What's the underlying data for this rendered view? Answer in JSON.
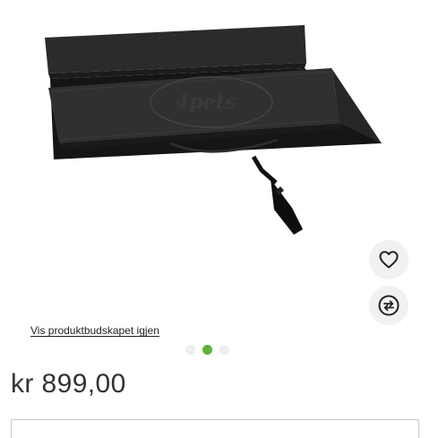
{
  "product": {
    "image_logo_text": "4pets",
    "alt": "4pets sammenleggbar bilkasse"
  },
  "actions": {
    "favorite_icon": "heart-outline-icon",
    "compare_icon": "compare-arrows-icon"
  },
  "link": {
    "revisit_label": "Vis produktbudskapet igjen"
  },
  "carousel": {
    "dot_count": 3,
    "active_index": 1,
    "active_color": "#5bb537",
    "inactive_color": "#eeeeee"
  },
  "price": {
    "label": "kr 899,00"
  }
}
